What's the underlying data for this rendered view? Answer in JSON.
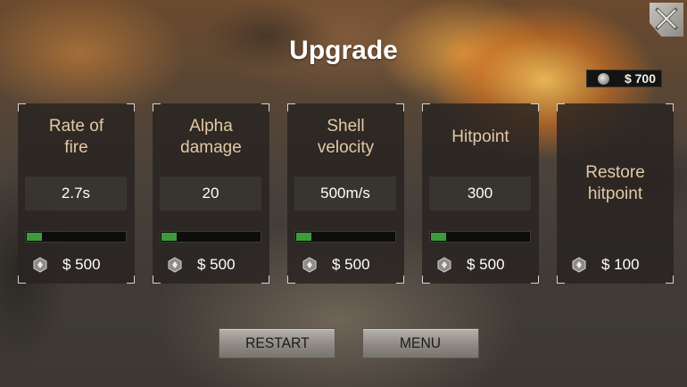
{
  "title": "Upgrade",
  "money": {
    "amount": "$ 700",
    "icon": "coin-icon"
  },
  "upgrades": [
    {
      "name": "Rate of\nfire",
      "value": "2.7s",
      "level_fraction": 0.15,
      "price": "$ 500"
    },
    {
      "name": "Alpha\ndamage",
      "value": "20",
      "level_fraction": 0.15,
      "price": "$ 500"
    },
    {
      "name": "Shell\nvelocity",
      "value": "500m/s",
      "level_fraction": 0.15,
      "price": "$ 500"
    },
    {
      "name": "Hitpoint",
      "value": "300",
      "level_fraction": 0.15,
      "price": "$ 500"
    },
    {
      "name": "Restore\nhitpoint",
      "value": "",
      "level_fraction": null,
      "price": "$ 100"
    }
  ],
  "buttons": {
    "restart": "RESTART",
    "menu": "MENU"
  },
  "colors": {
    "accent_title": "#e2c9a4",
    "bar_fill": "#3e9b3a"
  }
}
